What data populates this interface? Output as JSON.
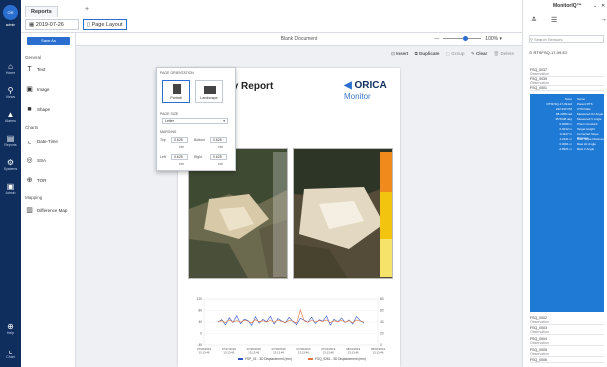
{
  "nav": {
    "user": "admin",
    "items": [
      {
        "id": "home",
        "label": "Home",
        "glyph": "⌂"
      },
      {
        "id": "views",
        "label": "Views",
        "glyph": "⚲"
      },
      {
        "id": "alarms",
        "label": "Alarms",
        "glyph": "▲"
      },
      {
        "id": "reports",
        "label": "Reports",
        "glyph": "▤"
      },
      {
        "id": "systems",
        "label": "Systems",
        "glyph": "⚙"
      },
      {
        "id": "admin",
        "label": "Admin",
        "glyph": "▣"
      },
      {
        "id": "help",
        "label": "Help",
        "glyph": "⊕"
      },
      {
        "id": "chart",
        "label": "Chart",
        "glyph": "⌞"
      }
    ]
  },
  "tabs": {
    "reports": "Reports"
  },
  "toolbar": {
    "datetime": "2019-07-26 15:15",
    "page_layout": "Page Layout"
  },
  "left_panel": {
    "save_as": "Save As",
    "general_label": "General",
    "charts_label": "Charts",
    "mapping_label": "Mapping",
    "items": {
      "text": "Text",
      "image": "Image",
      "shape": "Shape",
      "datetime": "Date-Time",
      "ssa": "SSA",
      "tor": "TOR",
      "diffmap": "Difference Map"
    }
  },
  "popup": {
    "orientation_label": "PAGE ORIENTATION",
    "portrait": "Portrait",
    "landscape": "Landscape",
    "size_label": "PAGE SIZE",
    "size": "Letter",
    "margins_label": "MARGINS",
    "top_label": "Top",
    "top_val": "0.625",
    "bottom_label": "Bottom",
    "bottom_val": "0.625",
    "left_label": "Left",
    "left_val": "0.625",
    "right_label": "Right",
    "right_val": "0.625",
    "unit": "cm"
  },
  "document": {
    "title": "Blank Document",
    "zoom": "100%",
    "tools": {
      "insert": "Insert",
      "duplicate": "Duplicate",
      "group": "Group",
      "clear": "Clear",
      "delete": "Delete"
    },
    "report_title": "Weekly Report",
    "logo_main": "ORICA",
    "logo_sub": "Monitor"
  },
  "colors": {
    "navy": "#0f2e5e",
    "accent": "#2a6fd0",
    "series1": "#2f56c9",
    "series2": "#e2733a"
  },
  "chart_data": {
    "type": "line",
    "x": [
      "07/26/2019 13:13:46",
      "07/27/2019 13:13:46",
      "07/28/2019 13:13:46",
      "07/29/2019 13:13:46",
      "07/30/2019 13:13:46",
      "07/31/2019 13:13:46",
      "08/01/2019 13:13:46",
      "08/02/2019 13:13:46"
    ],
    "ylabel_left_ticks": [
      "120",
      "80",
      "40",
      "0",
      "-40"
    ],
    "ylabel_right_ticks": [
      "80",
      "60",
      "40",
      "20",
      "0"
    ],
    "series": [
      {
        "name": "FSP_01 - 3D Displacement (mm)",
        "color": "#2f56c9",
        "values": [
          40,
          48,
          30,
          55,
          38,
          62,
          34,
          50,
          45,
          28,
          58,
          36,
          49,
          41,
          60,
          33,
          52,
          44,
          37,
          56,
          42,
          31,
          53,
          46,
          39,
          57,
          35,
          48,
          43,
          61,
          29,
          50,
          40,
          54,
          38,
          47,
          33,
          59,
          45,
          36
        ]
      },
      {
        "name": "FSQ_0261 - 3D Displacement (mm)",
        "color": "#e2733a",
        "values": [
          42,
          44,
          38,
          47,
          40,
          45,
          39,
          46,
          43,
          37,
          48,
          41,
          44,
          40,
          46,
          39,
          47,
          42,
          38,
          45,
          43,
          36,
          82,
          44,
          39,
          46,
          40,
          45,
          42,
          47,
          38,
          44,
          41,
          46,
          39,
          45,
          37,
          47,
          43,
          40
        ]
      }
    ]
  },
  "right_panel": {
    "brand": "MonitorIQ™",
    "search_placeholder": "Search Sensors",
    "selected_sensor": "RTSFSQ-17-09-E2",
    "entries": [
      "FSQ_0037",
      "FSQ_0039",
      "FSQ_0001",
      "FSQ_0002",
      "FSQ_0003",
      "FSQ_0004",
      "FSQ_0005",
      "FSQ_0006"
    ],
    "observation_label": "Observation",
    "sel_values": [
      "None",
      "RTSFSQ-17-09-E2",
      "222.932 PM",
      "88.4359 rad",
      "45.5348 deg",
      "0.0098 m",
      "0.0012 m",
      "0.1127 m",
      "2.2441 m",
      "0.0001 m",
      "-2.8921 m"
    ],
    "sel_labels": [
      "Name",
      "Parent RTS",
      "UTM Date",
      "Measured Hz Angle",
      "Measured V Angle",
      "Prism Constant",
      "Target Height",
      "Corrected Slope Distance",
      "Raw Slope Distance",
      "Raw Hz Angle",
      "Raw V Angle"
    ]
  }
}
